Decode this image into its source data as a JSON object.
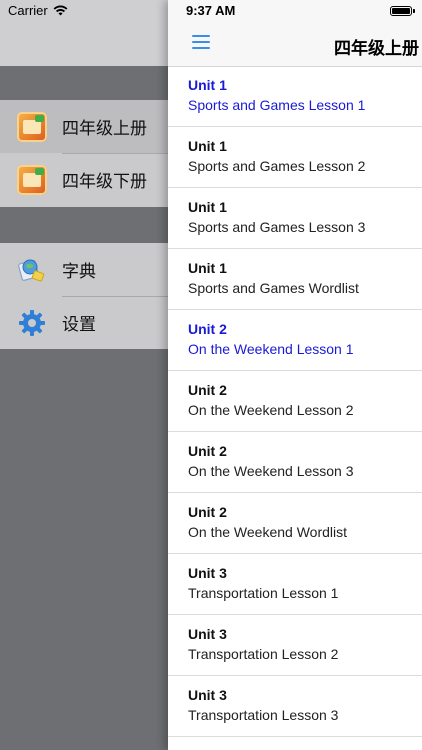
{
  "status": {
    "carrier": "Carrier",
    "time": "9:37 AM"
  },
  "nav": {
    "title": "四年级上册"
  },
  "drawer": {
    "books": [
      {
        "label": "四年级上册",
        "selected": true
      },
      {
        "label": "四年级下册",
        "selected": false
      }
    ],
    "tools": [
      {
        "label": "字典",
        "icon": "dictionary-icon"
      },
      {
        "label": "设置",
        "icon": "gear-icon"
      }
    ]
  },
  "lessons": [
    {
      "unit": "Unit 1",
      "title": "Sports and Games Lesson 1",
      "active": true
    },
    {
      "unit": "Unit 1",
      "title": "Sports and Games Lesson 2",
      "active": false
    },
    {
      "unit": "Unit 1",
      "title": "Sports and Games Lesson 3",
      "active": false
    },
    {
      "unit": "Unit 1",
      "title": "Sports and Games Wordlist",
      "active": false
    },
    {
      "unit": "Unit 2",
      "title": "On the Weekend Lesson 1",
      "active": true
    },
    {
      "unit": "Unit 2",
      "title": "On the Weekend Lesson 2",
      "active": false
    },
    {
      "unit": "Unit 2",
      "title": "On the Weekend Lesson 3",
      "active": false
    },
    {
      "unit": "Unit 2",
      "title": "On the Weekend Wordlist",
      "active": false
    },
    {
      "unit": "Unit 3",
      "title": "Transportation Lesson 1",
      "active": false
    },
    {
      "unit": "Unit 3",
      "title": "Transportation Lesson 2",
      "active": false
    },
    {
      "unit": "Unit 3",
      "title": "Transportation Lesson 3",
      "active": false
    }
  ],
  "colors": {
    "accent": "#3b8ee6",
    "active_text": "#1a1ad6"
  }
}
